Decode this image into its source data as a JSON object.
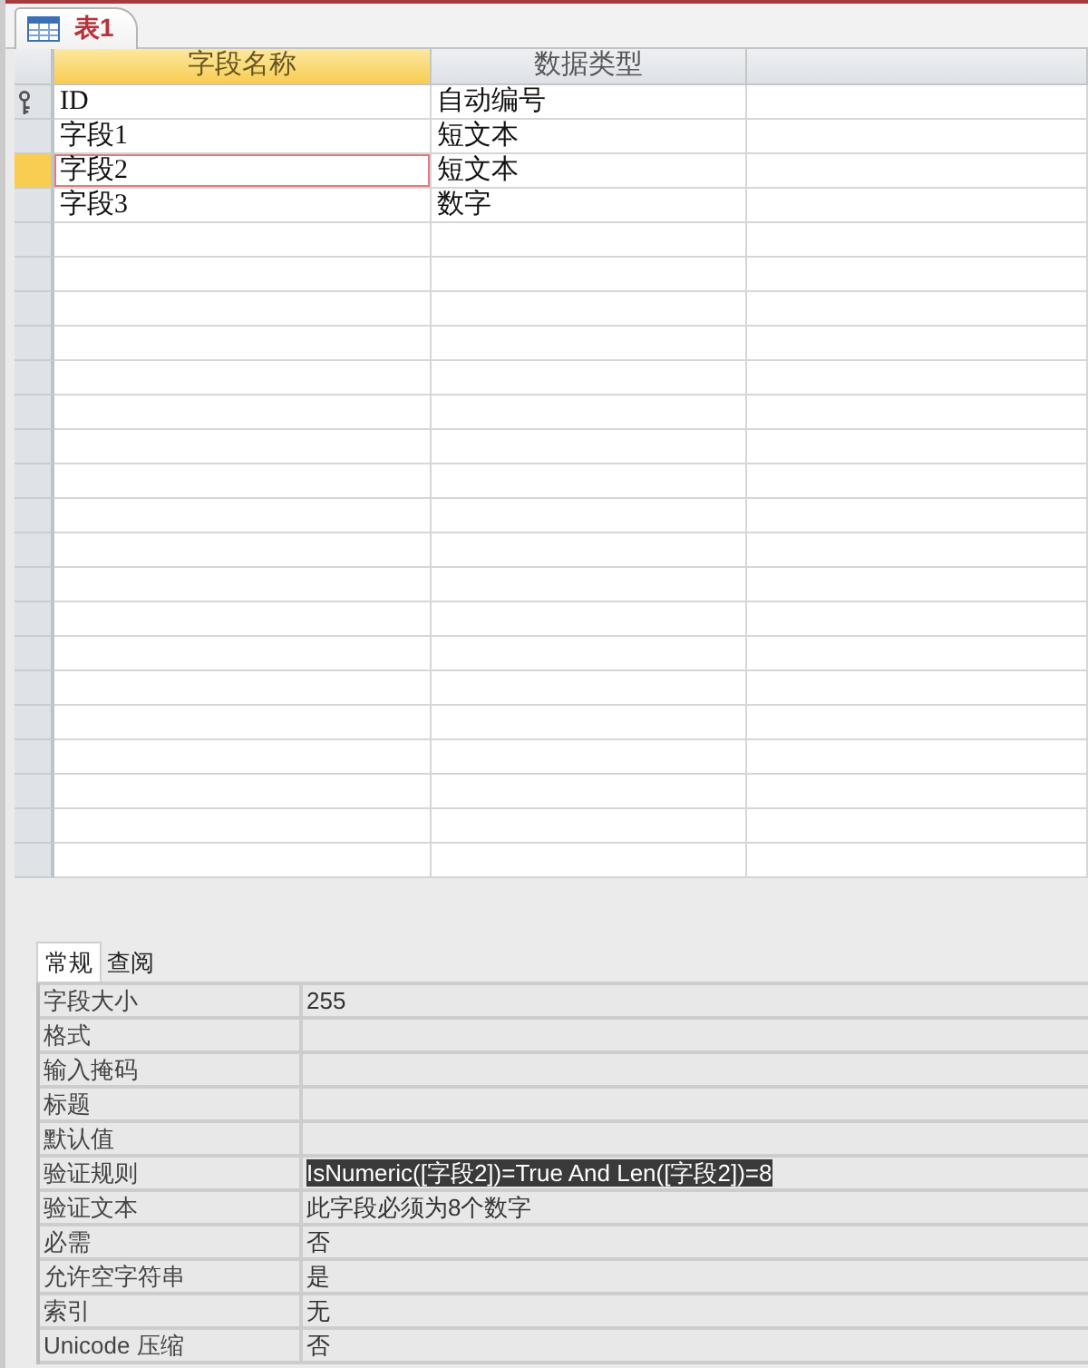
{
  "document_tab": {
    "title": "表1"
  },
  "columns": [
    {
      "label": "字段名称",
      "selected": true
    },
    {
      "label": "数据类型",
      "selected": false
    }
  ],
  "rows": [
    {
      "cells": [
        "ID",
        "自动编号"
      ],
      "primary_key": true,
      "selected": false
    },
    {
      "cells": [
        "字段1",
        "短文本"
      ],
      "primary_key": false,
      "selected": false
    },
    {
      "cells": [
        "字段2",
        "短文本"
      ],
      "primary_key": false,
      "selected": true
    },
    {
      "cells": [
        "字段3",
        "数字"
      ],
      "primary_key": false,
      "selected": false
    }
  ],
  "property_tabs": [
    {
      "label": "常规",
      "selected": true
    },
    {
      "label": "查阅",
      "selected": false
    }
  ],
  "properties": [
    {
      "label": "字段大小",
      "value": "255",
      "selected": false
    },
    {
      "label": "格式",
      "selected": false
    },
    {
      "label": "输入掩码",
      "selected": false
    },
    {
      "label": "标题",
      "selected": false
    },
    {
      "label": "默认值",
      "selected": false
    },
    {
      "label": "验证规则",
      "value": "IsNumeric([字段2])=True And Len([字段2])=8",
      "selected": true
    },
    {
      "label": "验证文本",
      "value": "此字段必须为8个数字",
      "selected": false
    },
    {
      "label": "必需",
      "value": "否",
      "selected": false
    },
    {
      "label": "允许空字符串",
      "value": "是",
      "selected": false
    },
    {
      "label": "索引",
      "value": "无",
      "selected": false
    },
    {
      "label": "Unicode 压缩",
      "value": "否",
      "selected": false
    }
  ]
}
